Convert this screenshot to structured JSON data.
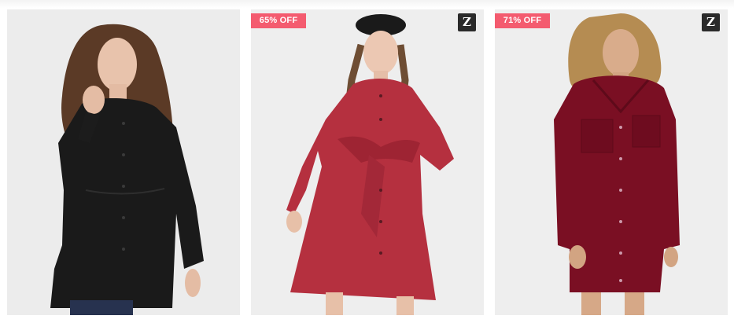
{
  "products": [
    {
      "id": "black-tiered-shirt",
      "badge": "",
      "brand": ""
    },
    {
      "id": "red-tie-front-shirt-dress",
      "badge": "65% OFF",
      "brand": "Z"
    },
    {
      "id": "burgundy-corduroy-shirt-dress",
      "badge": "71% OFF",
      "brand": "Z"
    }
  ],
  "colors": {
    "badge_bg": "#f45b6f",
    "card_bg": "#ebebeb",
    "brand_bg": "#2a2a2a"
  },
  "icons": {
    "brand": "zaful-logo-icon"
  }
}
